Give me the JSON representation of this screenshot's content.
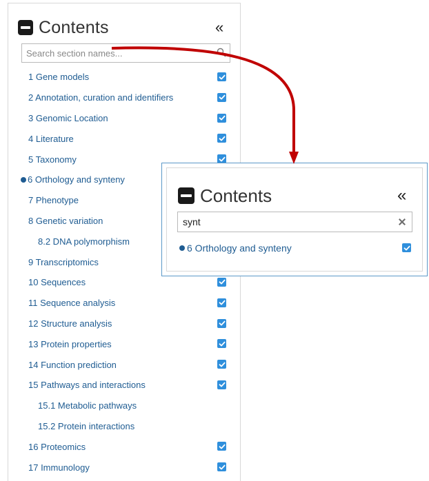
{
  "sidebar": {
    "title": "Contents",
    "collapse_icon": "«",
    "search_placeholder": "Search section names...",
    "items": [
      {
        "label": "1 Gene models",
        "checked": true
      },
      {
        "label": "2 Annotation, curation and identifiers",
        "checked": true
      },
      {
        "label": "3 Genomic Location",
        "checked": true
      },
      {
        "label": "4 Literature",
        "checked": true
      },
      {
        "label": "5 Taxonomy",
        "checked": true
      },
      {
        "label": "6 Orthology and synteny",
        "checked": true,
        "active": true
      },
      {
        "label": "7 Phenotype",
        "checked": true
      },
      {
        "label": "8 Genetic variation",
        "checked": true
      },
      {
        "label": "8.2 DNA polymorphism",
        "sub": true
      },
      {
        "label": "9 Transcriptomics",
        "checked": true
      },
      {
        "label": "10 Sequences",
        "checked": true
      },
      {
        "label": "11 Sequence analysis",
        "checked": true
      },
      {
        "label": "12 Structure analysis",
        "checked": true
      },
      {
        "label": "13 Protein properties",
        "checked": true
      },
      {
        "label": "14 Function prediction",
        "checked": true
      },
      {
        "label": "15 Pathways and interactions",
        "checked": true
      },
      {
        "label": "15.1 Metabolic pathways",
        "sub": true
      },
      {
        "label": "15.2 Protein interactions",
        "sub": true
      },
      {
        "label": "16 Proteomics",
        "checked": true
      },
      {
        "label": "17 Immunology",
        "checked": true
      }
    ]
  },
  "popup": {
    "title": "Contents",
    "collapse_icon": "«",
    "search_value": "synt",
    "result_label": "6 Orthology and synteny"
  },
  "colors": {
    "link": "#1f5c92",
    "checkbox": "#2f8fdc",
    "arrow": "#c00000",
    "popup_border": "#5a97c8"
  },
  "icons": [
    "minus-box-icon",
    "double-chevron-left-icon",
    "search-icon",
    "checkbox-checked-icon",
    "clear-x-icon",
    "arrow-icon"
  ]
}
